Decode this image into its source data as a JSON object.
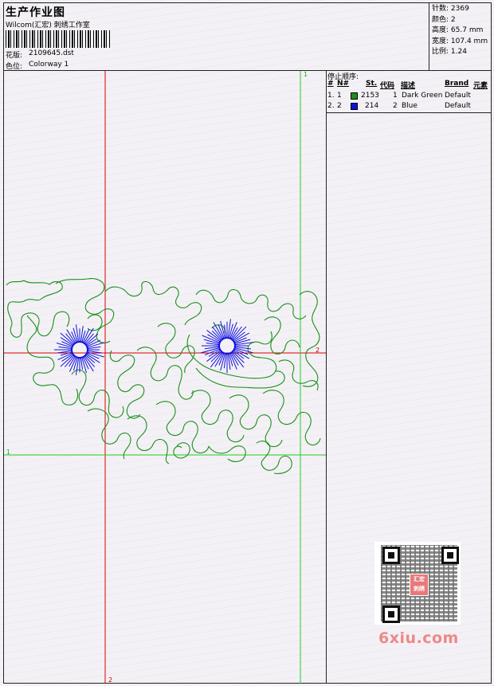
{
  "header": {
    "title": "生产作业图",
    "company": "Wilcom(汇宏) 刺绣工作室",
    "design_label": "花版:",
    "design_value": "2109645.dst",
    "colorway_label": "色位:",
    "colorway_value": "Colorway 1"
  },
  "stats": [
    {
      "label": "针数:",
      "value": "2369"
    },
    {
      "label": "颜色:",
      "value": "2"
    },
    {
      "label": "高度:",
      "value": "65.7 mm"
    },
    {
      "label": "宽度:",
      "value": "107.4 mm"
    },
    {
      "label": "比例:",
      "value": "1.24"
    }
  ],
  "stop_sequence": {
    "title": "停止顺序:",
    "columns": [
      "#",
      "N#",
      "St.",
      "代码",
      "描述",
      "Brand",
      "元素"
    ],
    "rows": [
      {
        "index": "1.",
        "n": "1",
        "color": "#1a8f1a",
        "stitches": "2153",
        "code": "1",
        "description": "Dark Green",
        "brand": "Default"
      },
      {
        "index": "2.",
        "n": "2",
        "color": "#1010e0",
        "stitches": "214",
        "code": "2",
        "description": "Blue",
        "brand": "Default"
      }
    ]
  },
  "guides": {
    "green_top_label": "1",
    "green_left_label": "1",
    "red_right_label": "2",
    "red_bottom_label": "2"
  },
  "colors": {
    "green_stitch": "#1a8f1a",
    "blue_stitch": "#1010e0",
    "red_guide": "#dd0000",
    "green_guide": "#22cc22"
  },
  "watermark": {
    "text": "6xiu.com",
    "stamp_line1": "汇宏",
    "stamp_line2": "刺绣"
  }
}
